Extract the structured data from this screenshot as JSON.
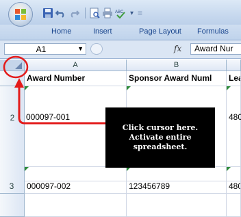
{
  "window": {
    "title_bar_separator": "="
  },
  "quick_access": {
    "icons": [
      "save-icon",
      "undo-icon",
      "redo-icon",
      "print-preview-icon",
      "print-icon",
      "spelling-icon"
    ]
  },
  "ribbon": {
    "tabs": [
      "Home",
      "Insert",
      "Page Layout",
      "Formulas"
    ]
  },
  "formula_bar": {
    "name_box": "A1",
    "fx_label": "fx",
    "content": "Award Nur"
  },
  "sheet": {
    "columns": [
      "A",
      "B"
    ],
    "rows": [
      {
        "number": "",
        "cells": [
          "Award Number",
          "Sponsor Award Numl",
          "Lea"
        ]
      },
      {
        "number": "2",
        "cells": [
          "000097-001",
          "",
          "480"
        ]
      },
      {
        "number": "3",
        "cells": [
          "000097-002",
          "123456789",
          "480"
        ]
      }
    ]
  },
  "callout": {
    "lines": [
      "Click cursor here.",
      "Activate entire",
      "spreadsheet."
    ]
  },
  "colors": {
    "annotation_red": "#e31b1b",
    "callout_bg": "#000000",
    "header_blue": "#dbe6f4"
  }
}
